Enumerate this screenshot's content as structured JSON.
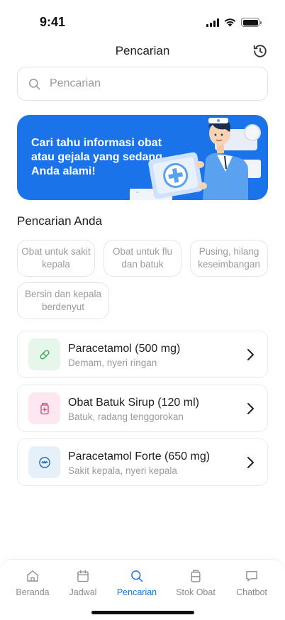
{
  "status_bar": {
    "time": "9:41"
  },
  "header": {
    "title": "Pencarian",
    "history_icon": "history-icon"
  },
  "search": {
    "placeholder": "Pencarian",
    "value": ""
  },
  "banner": {
    "text": "Cari tahu informasi obat atau gejala yang sedang Anda alami!",
    "color": "#1a73e8"
  },
  "section": {
    "title": "Pencarian Anda"
  },
  "chips": [
    {
      "label": "Obat untuk sakit kepala"
    },
    {
      "label": "Obat untuk flu dan batuk"
    },
    {
      "label": "Pusing, hilang keseimbangan"
    },
    {
      "label": "Bersin dan kepala berdenyut"
    }
  ],
  "results": [
    {
      "title": "Paracetamol (500 mg)",
      "subtitle": "Demam, nyeri ringan",
      "icon": "pill-icon",
      "icon_bg": "#e6f6ea"
    },
    {
      "title": "Obat Batuk Sirup (120 ml)",
      "subtitle": "Batuk, radang tenggorokan",
      "icon": "syrup-bottle-icon",
      "icon_bg": "#fde8f1"
    },
    {
      "title": "Paracetamol Forte (650 mg)",
      "subtitle": "Sakit kepala, nyeri kepala",
      "icon": "tablet-icon",
      "icon_bg": "#e6f0fb"
    }
  ],
  "nav": {
    "active": "Pencarian",
    "items": [
      {
        "label": "Beranda",
        "icon": "home-icon"
      },
      {
        "label": "Jadwal",
        "icon": "calendar-icon"
      },
      {
        "label": "Pencarian",
        "icon": "search-icon"
      },
      {
        "label": "Stok Obat",
        "icon": "medicine-box-icon"
      },
      {
        "label": "Chatbot",
        "icon": "chat-icon"
      }
    ]
  },
  "colors": {
    "accent": "#1a73e8",
    "muted": "#9b9b9b",
    "border": "#ececec"
  }
}
